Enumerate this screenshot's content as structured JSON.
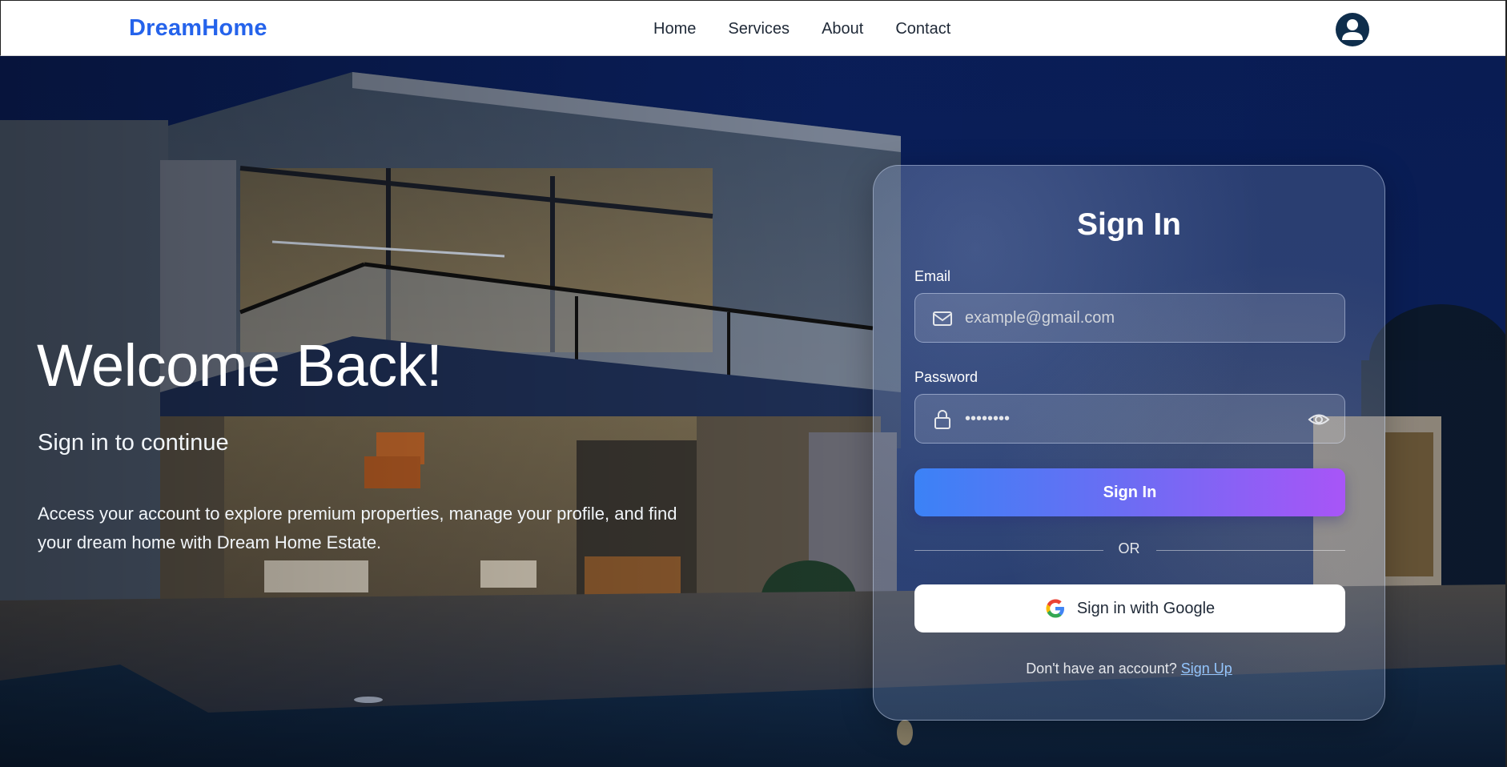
{
  "brand": "DreamHome",
  "nav": {
    "links": [
      "Home",
      "Services",
      "About",
      "Contact"
    ]
  },
  "hero": {
    "title": "Welcome Back!",
    "subtitle": "Sign in to continue",
    "description": "Access your account to explore premium properties, manage your profile, and find your dream home with Dream Home Estate."
  },
  "signin": {
    "title": "Sign In",
    "email_label": "Email",
    "email_placeholder": "example@gmail.com",
    "password_label": "Password",
    "password_value": "••••••••",
    "submit_label": "Sign In",
    "or_text": "OR",
    "google_label": "Sign in with Google",
    "signup_prompt": "Don't have an account?",
    "signup_link": "Sign Up"
  },
  "colors": {
    "brand": "#2563eb",
    "gradient_start": "#3b82f6",
    "gradient_end": "#a855f7",
    "signup_link": "#93c5fd"
  },
  "icons": {
    "avatar": "user-avatar-icon",
    "email": "mail-icon",
    "password": "lock-icon",
    "toggle": "eye-icon",
    "google": "google-icon"
  }
}
